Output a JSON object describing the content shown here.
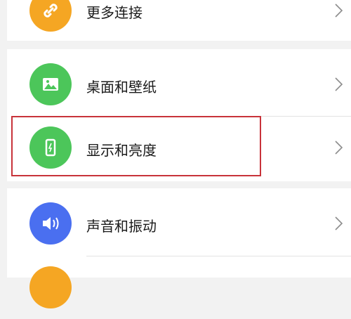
{
  "settings": {
    "items": [
      {
        "label": "更多连接",
        "icon": "link-icon",
        "color": "#f5a623"
      },
      {
        "label": "桌面和壁纸",
        "icon": "image-icon",
        "color": "#4cc65a"
      },
      {
        "label": "显示和亮度",
        "icon": "phone-brightness-icon",
        "color": "#4cc65a"
      },
      {
        "label": "声音和振动",
        "icon": "speaker-icon",
        "color": "#4a6ff0"
      },
      {
        "label": "",
        "icon": "partial-icon",
        "color": "#f5a623"
      }
    ]
  },
  "colors": {
    "background": "#f2f2f2",
    "card": "#ffffff",
    "highlight_border": "#c8333a",
    "chevron": "#8c8c8c"
  }
}
